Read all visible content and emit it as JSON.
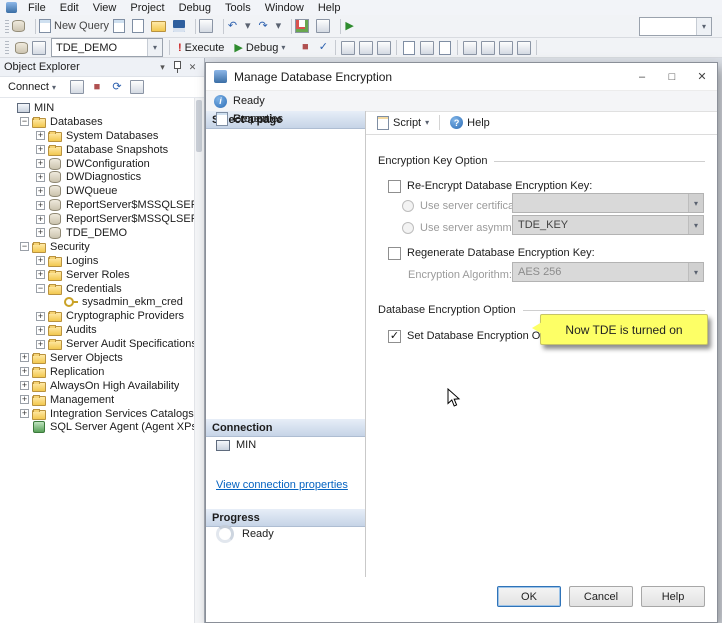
{
  "ui": {
    "caret": "▾",
    "info": "i",
    "question": "?",
    "check": "✓",
    "minimize": "–",
    "maximize": "□",
    "close": "✕",
    "chevron": "▾"
  },
  "menubar": {
    "items": [
      {
        "label": "File"
      },
      {
        "label": "Edit"
      },
      {
        "label": "View"
      },
      {
        "label": "Project"
      },
      {
        "label": "Debug"
      },
      {
        "label": "Tools"
      },
      {
        "label": "Window"
      },
      {
        "label": "Help"
      }
    ]
  },
  "toolbar1": {
    "combo_value": "",
    "items": [
      {
        "name": "manage-connections-icon",
        "cls": "ic-db"
      },
      {
        "sep": true
      },
      {
        "name": "new-query-button",
        "cls": "ic-newquery",
        "label": "New Query"
      },
      {
        "name": "new-database-engine-query-icon",
        "cls": "ic-newquery"
      },
      {
        "name": "new-analysis-query-icon",
        "cls": "ic-doc"
      },
      {
        "name": "open-file-icon",
        "cls": "ic-folder"
      },
      {
        "name": "save-icon",
        "cls": "ic-save"
      },
      {
        "sep": true
      },
      {
        "name": "print-icon",
        "cls": "ic-generic"
      },
      {
        "sep": true
      },
      {
        "name": "undo-icon",
        "glyph": "↶",
        "cls": "ic-blue"
      },
      {
        "name": "undo-dropdown-icon",
        "glyph": "▾",
        "cls": "ic-caret"
      },
      {
        "name": "redo-icon",
        "glyph": "↷",
        "cls": "ic-blue"
      },
      {
        "name": "redo-dropdown-icon",
        "glyph": "▾",
        "cls": "ic-caret"
      },
      {
        "sep": true
      },
      {
        "name": "activity-monitor-icon",
        "cls": "ic-chart"
      },
      {
        "name": "find-icon",
        "cls": "ic-generic"
      },
      {
        "sep": true
      },
      {
        "name": "start-powershell-icon",
        "glyph": "▶",
        "cls": "ic-green"
      }
    ]
  },
  "toolbar2": {
    "left_icons": [
      {
        "name": "change-connection-icon",
        "cls": "ic-db"
      },
      {
        "name": "available-databases-icon",
        "cls": "ic-generic"
      }
    ],
    "database_combo": "TDE_DEMO",
    "execute_glyph": "!",
    "execute_label": "Execute",
    "debug_glyph": "▶",
    "debug_label": "Debug",
    "right_icons": [
      {
        "name": "stop-icon",
        "glyph": "■",
        "cls": "ic-stop"
      },
      {
        "name": "parse-icon",
        "glyph": "✓",
        "cls": "ic-check"
      },
      {
        "sep": true
      },
      {
        "name": "estimated-plan-icon",
        "cls": "ic-generic"
      },
      {
        "name": "query-options-icon",
        "cls": "ic-generic"
      },
      {
        "name": "intellisense-icon",
        "cls": "ic-generic"
      },
      {
        "sep": true
      },
      {
        "name": "results-to-text-icon",
        "cls": "ic-doc"
      },
      {
        "name": "results-to-grid-icon",
        "cls": "ic-generic"
      },
      {
        "name": "results-to-file-icon",
        "cls": "ic-doc"
      },
      {
        "sep": true
      },
      {
        "name": "comment-icon",
        "cls": "ic-generic"
      },
      {
        "name": "uncomment-icon",
        "cls": "ic-generic"
      },
      {
        "name": "indent-icon",
        "cls": "ic-generic"
      },
      {
        "name": "outdent-icon",
        "cls": "ic-generic"
      },
      {
        "sep": true
      }
    ]
  },
  "object_explorer": {
    "title": "Object Explorer",
    "connect_label": "Connect",
    "toolbar_icons": [
      {
        "name": "disconnect-icon",
        "cls": "ic-generic"
      },
      {
        "name": "stop-icon",
        "glyph": "■",
        "cls": "ic-stop"
      },
      {
        "name": "refresh-icon",
        "glyph": "⟳",
        "cls": "ic-check"
      },
      {
        "name": "filter-icon",
        "cls": "ic-generic"
      }
    ],
    "tree": [
      {
        "label": "MIN",
        "level": 0,
        "expand": "none",
        "icon": "server"
      },
      {
        "label": "Databases",
        "level": 1,
        "expand": "minus",
        "icon": "folder"
      },
      {
        "label": "System Databases",
        "level": 2,
        "expand": "plus",
        "icon": "folder"
      },
      {
        "label": "Database Snapshots",
        "level": 2,
        "expand": "plus",
        "icon": "folder"
      },
      {
        "label": "DWConfiguration",
        "level": 2,
        "expand": "plus",
        "icon": "db"
      },
      {
        "label": "DWDiagnostics",
        "level": 2,
        "expand": "plus",
        "icon": "db"
      },
      {
        "label": "DWQueue",
        "level": 2,
        "expand": "plus",
        "icon": "db"
      },
      {
        "label": "ReportServer$MSSQLSERVER",
        "level": 2,
        "expand": "plus",
        "icon": "db"
      },
      {
        "label": "ReportServer$MSSQLSERVER",
        "level": 2,
        "expand": "plus",
        "icon": "db"
      },
      {
        "label": "TDE_DEMO",
        "level": 2,
        "expand": "plus",
        "icon": "db"
      },
      {
        "label": "Security",
        "level": 1,
        "expand": "minus",
        "icon": "folder"
      },
      {
        "label": "Logins",
        "level": 2,
        "expand": "plus",
        "icon": "folder"
      },
      {
        "label": "Server Roles",
        "level": 2,
        "expand": "plus",
        "icon": "folder"
      },
      {
        "label": "Credentials",
        "level": 2,
        "expand": "minus",
        "icon": "folder"
      },
      {
        "label": "sysadmin_ekm_cred",
        "level": 3,
        "expand": "none",
        "icon": "cred"
      },
      {
        "label": "Cryptographic Providers",
        "level": 2,
        "expand": "plus",
        "icon": "folder"
      },
      {
        "label": "Audits",
        "level": 2,
        "expand": "plus",
        "icon": "folder"
      },
      {
        "label": "Server Audit Specifications",
        "level": 2,
        "expand": "plus",
        "icon": "folder"
      },
      {
        "label": "Server Objects",
        "level": 1,
        "expand": "plus",
        "icon": "folder"
      },
      {
        "label": "Replication",
        "level": 1,
        "expand": "plus",
        "icon": "folder"
      },
      {
        "label": "AlwaysOn High Availability",
        "level": 1,
        "expand": "plus",
        "icon": "folder"
      },
      {
        "label": "Management",
        "level": 1,
        "expand": "plus",
        "icon": "folder"
      },
      {
        "label": "Integration Services Catalogs",
        "level": 1,
        "expand": "plus",
        "icon": "folder"
      },
      {
        "label": "SQL Server Agent (Agent XPs disabl",
        "level": 1,
        "expand": "none",
        "icon": "agent"
      }
    ]
  },
  "dialog": {
    "title": "Manage Database Encryption",
    "status": "Ready",
    "select_page": {
      "header": "Select a page",
      "items": [
        {
          "label": "General",
          "name": "page-item-general"
        },
        {
          "label": "Properties",
          "name": "page-item-properties"
        }
      ]
    },
    "toolbar": {
      "script_label": "Script",
      "help_label": "Help"
    },
    "content": {
      "group1_title": "Encryption Key Option",
      "reencrypt_label": "Re-Encrypt Database Encryption Key:",
      "cert_label": "Use server certificate:",
      "cert_value": "",
      "asym_label": "Use server asymmetric key:",
      "asym_value": "TDE_KEY",
      "regen_label": "Regenerate Database Encryption Key:",
      "algo_label": "Encryption Algorithm:",
      "algo_value": "AES 256",
      "group2_title": "Database Encryption Option",
      "set_encryption_label": "Set Database Encryption On",
      "set_encryption_checked": "✓",
      "callout_text": "Now TDE is turned on",
      "callout_bg": "#fdff66"
    },
    "connection": {
      "header": "Connection",
      "server": "MIN",
      "link": "View connection properties"
    },
    "progress": {
      "header": "Progress",
      "status": "Ready"
    },
    "buttons": [
      {
        "label": "OK",
        "name": "ok-button",
        "cls": "btn-default"
      },
      {
        "label": "Cancel",
        "name": "cancel-button"
      },
      {
        "label": "Help",
        "name": "help-button"
      }
    ]
  }
}
